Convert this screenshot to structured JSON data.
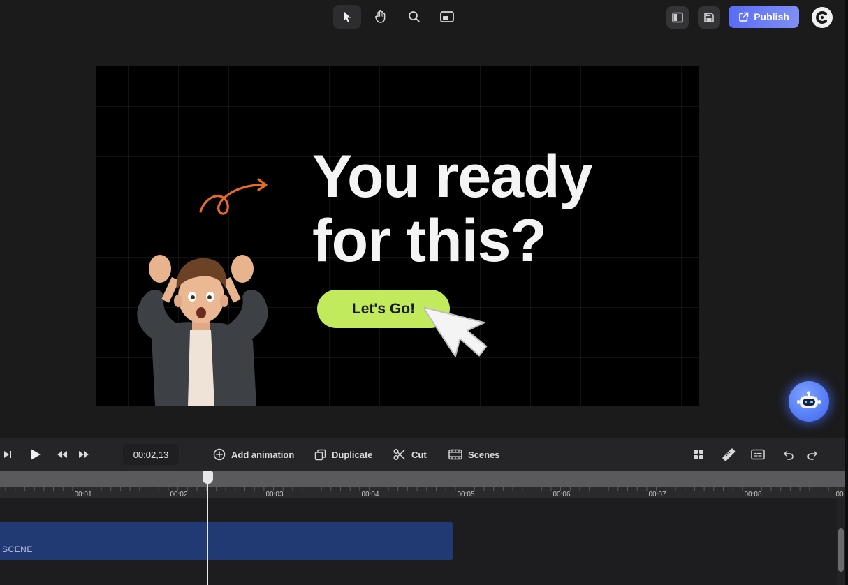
{
  "toolbar": {
    "tools": [
      {
        "name": "select",
        "icon": "cursor-icon",
        "active": true
      },
      {
        "name": "pan",
        "icon": "hand-icon",
        "active": false
      },
      {
        "name": "zoom",
        "icon": "magnifier-icon",
        "active": false
      },
      {
        "name": "frame",
        "icon": "frame-icon",
        "active": false
      }
    ],
    "publish_label": "Publish"
  },
  "canvas": {
    "headline_line1": "You ready",
    "headline_line2": "for this?",
    "cta_label": "Let's Go!",
    "cta_color": "#c2ea5d"
  },
  "controls": {
    "time": "00:02,13",
    "actions": {
      "add_animation": "Add animation",
      "duplicate": "Duplicate",
      "cut": "Cut",
      "scenes": "Scenes"
    }
  },
  "timeline": {
    "tick_labels": [
      "00:01",
      "00:02",
      "00:03",
      "00:04",
      "00:05",
      "00:06",
      "00:07",
      "00:08",
      "00"
    ],
    "playhead_time": "00:02,13",
    "clip_label": "SCENE",
    "clip_color": "#213a73"
  },
  "colors": {
    "accent": "#5a6cf5",
    "background": "#1b1b1c"
  }
}
